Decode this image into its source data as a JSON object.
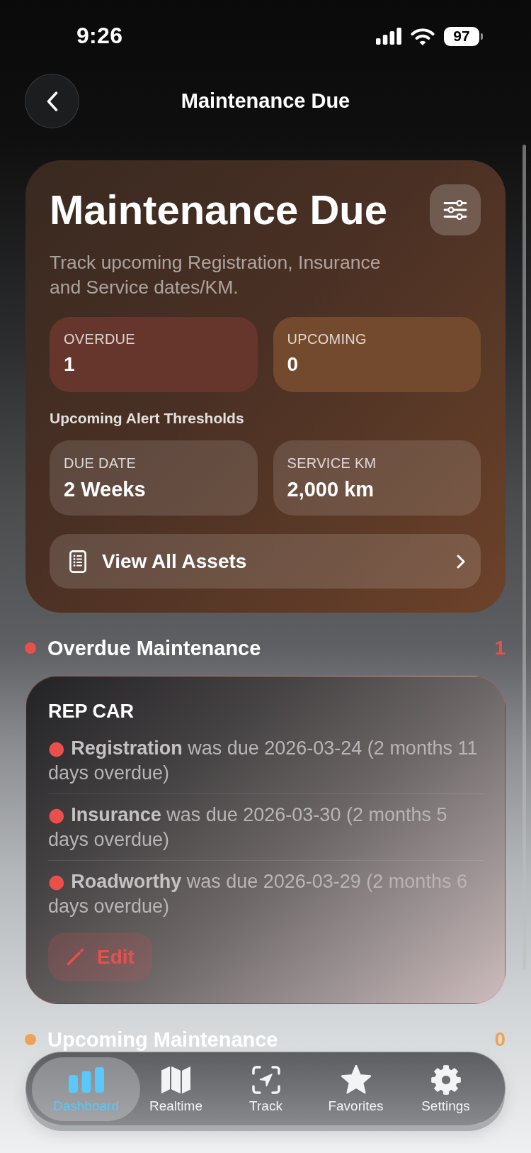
{
  "status_bar": {
    "time": "9:26",
    "battery": "97"
  },
  "nav": {
    "title": "Maintenance Due"
  },
  "summary": {
    "title": "Maintenance Due",
    "subtitle": "Track upcoming Registration, Insurance and Service dates/KM.",
    "stats": [
      {
        "kind": "overdue",
        "label": "OVERDUE",
        "value": "1"
      },
      {
        "kind": "upcoming",
        "label": "UPCOMING",
        "value": "0"
      }
    ],
    "thresholds_heading": "Upcoming Alert Thresholds",
    "thresholds": [
      {
        "label": "DUE DATE",
        "value": "2 Weeks"
      },
      {
        "label": "SERVICE KM",
        "value": "2,000 km"
      }
    ],
    "view_all": "View All Assets"
  },
  "sections": [
    {
      "title": "Overdue Maintenance",
      "count": "1",
      "color": "#eb4f4c",
      "assets": [
        {
          "name": "REP CAR",
          "items": [
            {
              "bullet": "●",
              "text": "**Registration** was due 2026-03-24 (2 months 11 days overdue)"
            },
            {
              "bullet": "●",
              "text": "**Insurance** was due 2026-03-30 (2 months 5 days overdue)"
            },
            {
              "bullet": "●",
              "text": "**Roadworthy** was due 2026-03-29 (2 months 6 days overdue)"
            }
          ],
          "action": "Edit"
        }
      ]
    },
    {
      "title": "Upcoming Maintenance",
      "count": "0",
      "color": "#eea256"
    }
  ],
  "tab_bar": {
    "tabs": [
      {
        "label": "Dashboard",
        "selected": true
      },
      {
        "label": "Realtime",
        "selected": false
      },
      {
        "label": "Track",
        "selected": false
      },
      {
        "label": "Favorites",
        "selected": false
      },
      {
        "label": "Settings",
        "selected": false
      }
    ]
  }
}
